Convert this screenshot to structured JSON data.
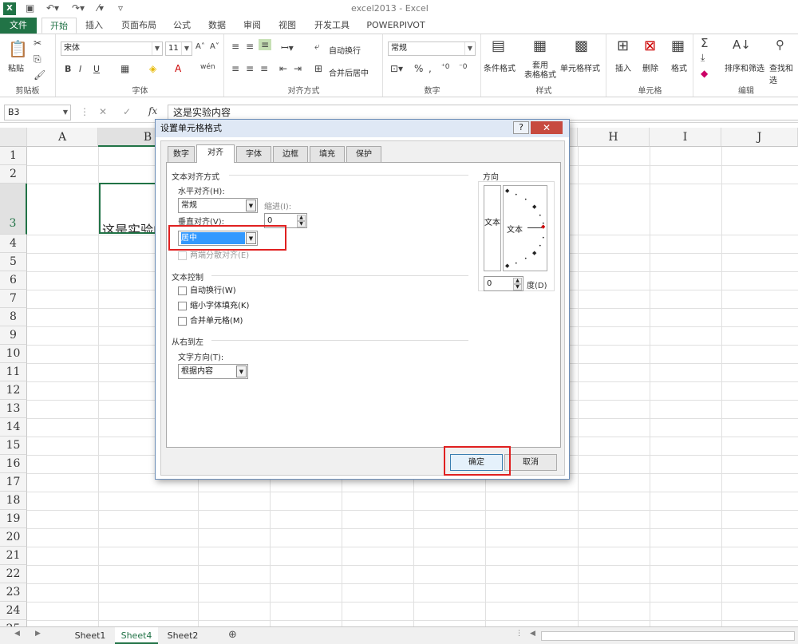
{
  "app": {
    "title": "excel2013 - Excel"
  },
  "ribbon_tabs": [
    "文件",
    "开始",
    "插入",
    "页面布局",
    "公式",
    "数据",
    "审阅",
    "视图",
    "开发工具",
    "POWERPIVOT"
  ],
  "ribbon": {
    "clipboard": {
      "paste": "粘贴",
      "label": "剪贴板"
    },
    "font": {
      "name": "宋体",
      "size": "11",
      "label": "字体",
      "bold": "B",
      "italic": "I",
      "underline": "U"
    },
    "alignment": {
      "wrap": "自动换行",
      "merge": "合并后居中",
      "label": "对齐方式"
    },
    "number": {
      "format": "常规",
      "label": "数字"
    },
    "styles": {
      "cond": "条件格式",
      "table": "套用\n表格格式",
      "cell": "单元格样式",
      "label": "样式"
    },
    "cells": {
      "insert": "插入",
      "delete": "删除",
      "format": "格式",
      "label": "单元格"
    },
    "editing": {
      "sort": "排序和筛选",
      "find": "查找和选",
      "label": "编辑"
    }
  },
  "formula_bar": {
    "name_box": "B3",
    "fx": "fx",
    "content": "这是实验内容"
  },
  "columns": [
    "A",
    "B",
    "C",
    "D",
    "E",
    "F",
    "G",
    "H",
    "I",
    "J"
  ],
  "rows": [
    "1",
    "2",
    "3",
    "4",
    "5",
    "6",
    "7",
    "8",
    "9",
    "10",
    "11",
    "12",
    "13",
    "14",
    "15",
    "16",
    "17",
    "18",
    "19",
    "20",
    "21",
    "22",
    "23",
    "24",
    "25"
  ],
  "cell_b3": "这是实验内容",
  "sheets": [
    "Sheet1",
    "Sheet4",
    "Sheet2"
  ],
  "dialog": {
    "title": "设置单元格格式",
    "tabs": [
      "数字",
      "对齐",
      "字体",
      "边框",
      "填充",
      "保护"
    ],
    "text_align_section": "文本对齐方式",
    "horizontal_label": "水平对齐(H):",
    "horizontal_value": "常规",
    "indent_label": "缩进(I):",
    "indent_value": "0",
    "vertical_label": "垂直对齐(V):",
    "vertical_value": "居中",
    "distributed": "两端分散对齐(E)",
    "text_control_section": "文本控制",
    "wrap": "自动换行(W)",
    "shrink": "缩小字体填充(K)",
    "merge": "合并单元格(M)",
    "rtl_section": "从右到左",
    "direction_label": "文字方向(T):",
    "direction_value": "根据内容",
    "orientation_section": "方向",
    "vertical_text": "文本",
    "orient_text": "文本",
    "degree_value": "0",
    "degree_label": "度(D)",
    "ok": "确定",
    "cancel": "取消"
  },
  "colors": {
    "accent": "#217346",
    "highlight": "#e02020",
    "selection": "#3399ff"
  }
}
